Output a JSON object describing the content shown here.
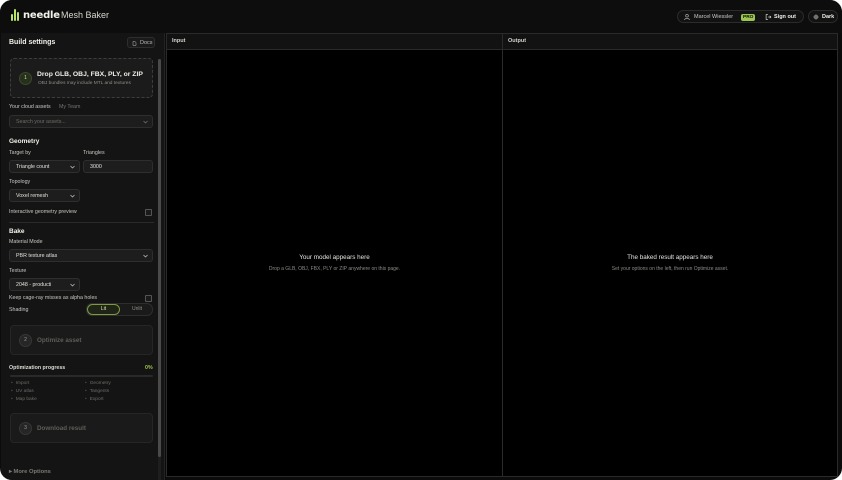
{
  "app": {
    "logo_text": "needle",
    "name": "Mesh Baker"
  },
  "user": {
    "name": "Marcel Wiessler",
    "badge": "PRO",
    "sign_out": "Sign out",
    "theme": "Dark"
  },
  "sidebar": {
    "title": "Build settings",
    "docs": "Docs",
    "drop": {
      "step": "1",
      "title": "Drop GLB, OBJ, FBX, PLY, or ZIP",
      "subtitle": "OBJ bundles may include MTL and textures"
    },
    "cloud": {
      "label": "Your cloud assets",
      "team": "My Team",
      "search_placeholder": "Search your assets..."
    },
    "geometry": {
      "heading": "Geometry",
      "target_label": "Target by",
      "target_value": "Triangle count",
      "triangles_label": "Triangles",
      "triangles_value": "3000",
      "topology_label": "Topology",
      "topology_value": "Voxel remesh",
      "preview_label": "Interactive geometry preview"
    },
    "bake": {
      "heading": "Bake",
      "material_label": "Material Mode",
      "material_value": "PBR texture atlas",
      "texture_label": "Texture",
      "texture_value": "2048 - producti",
      "cage_label": "Keep cage-ray misses as alpha holes",
      "shading_label": "Shading",
      "shading_lit": "Lit",
      "shading_unlit": "Unlit"
    },
    "optimize": {
      "step": "2",
      "label": "Optimize asset"
    },
    "progress": {
      "label": "Optimization progress",
      "percent_text": "0%",
      "value": 0,
      "tasks": [
        "Import",
        "Geometry",
        "UV atlas",
        "Tangents",
        "Map bake",
        "Export"
      ]
    },
    "download": {
      "step": "3",
      "label": "Download result"
    },
    "more_options": "More Options"
  },
  "input_pane": {
    "title": "Input",
    "message": "Your model appears here",
    "hint": "Drop a GLB, OBJ, FBX, PLY or ZIP anywhere on this page."
  },
  "output_pane": {
    "title": "Output",
    "message": "The baked result appears here",
    "hint": "Set your options on the left, then run Optimize asset."
  },
  "colors": {
    "accent": "#9bc651",
    "background": "#0b0b0b",
    "panel": "#141414"
  }
}
